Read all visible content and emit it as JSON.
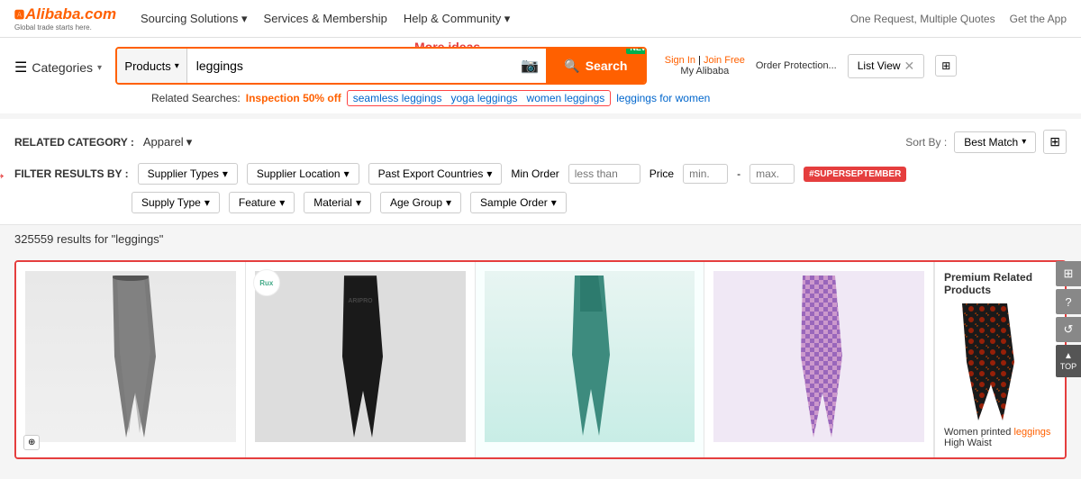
{
  "logo": {
    "text": "Alibaba.com",
    "tagline": "Global trade starts here."
  },
  "topnav": {
    "links": [
      {
        "label": "Sourcing Solutions",
        "has_arrow": true
      },
      {
        "label": "Services & Membership",
        "has_arrow": true
      },
      {
        "label": "Help & Community",
        "has_arrow": true
      }
    ],
    "right": {
      "quote": "One Request, Multiple Quotes",
      "app": "Get the App"
    }
  },
  "search": {
    "dropdown_label": "Products",
    "input_value": "leggings",
    "button_label": "Search",
    "camera_label": "📷",
    "more_ideas": "More ideas"
  },
  "related": {
    "label": "Related Searches:",
    "promo": "Inspection 50% off",
    "highlighted": [
      "seamless leggings",
      "yoga leggings",
      "women leggings"
    ],
    "plain": [
      "leggings for women"
    ]
  },
  "user": {
    "sign_in": "Sign In",
    "join_free": "Join Free",
    "my_alibaba": "My Alibaba",
    "order_protection": "Order Protection...",
    "list_view": "List View"
  },
  "categories_bar": {
    "icon": "☰",
    "label": "Categories",
    "arrow": "▾"
  },
  "related_category": {
    "label": "RELATED CATEGORY :",
    "value": "Apparel",
    "arrow": "▾"
  },
  "sort": {
    "label": "Sort By :",
    "value": "Best Match",
    "arrow": "▾"
  },
  "filters": {
    "label": "FILTER RESULTS BY :",
    "row1": [
      {
        "label": "Supplier Types",
        "arrow": "▾"
      },
      {
        "label": "Supplier Location",
        "arrow": "▾"
      },
      {
        "label": "Past Export Countries",
        "arrow": "▾"
      }
    ],
    "min_order_label": "Min Order",
    "min_order_placeholder": "less than",
    "price_label": "Price",
    "price_min_placeholder": "min.",
    "price_max_placeholder": "max.",
    "super_sept": "#SUPERSEPTEMBER",
    "row2": [
      {
        "label": "Supply Type",
        "arrow": "▾"
      },
      {
        "label": "Feature",
        "arrow": "▾"
      },
      {
        "label": "Material",
        "arrow": "▾"
      },
      {
        "label": "Age Group",
        "arrow": "▾"
      },
      {
        "label": "Sample Order",
        "arrow": "▾"
      }
    ]
  },
  "results": {
    "count": "325559",
    "query": "leggings",
    "text": "325559 results for \"leggings\""
  },
  "products": [
    {
      "id": 1,
      "color": "gray",
      "alt": "Gray leggings"
    },
    {
      "id": 2,
      "color": "black",
      "alt": "Black compression leggings",
      "brand": "Rux"
    },
    {
      "id": 3,
      "color": "teal",
      "alt": "Teal leggings"
    },
    {
      "id": 4,
      "color": "purple-checker",
      "alt": "Purple checkered leggings"
    }
  ],
  "premium": {
    "title": "Premium Related Products",
    "desc": "Women printed",
    "link_text": "leggings",
    "desc2": "High Waist"
  },
  "right_tools": [
    {
      "icon": "⊞",
      "label": "rfq"
    },
    {
      "icon": "?",
      "label": "help"
    },
    {
      "icon": "↺",
      "label": "recent"
    },
    {
      "icon": "▲\nTOP",
      "label": "top",
      "is_top": true
    }
  ]
}
